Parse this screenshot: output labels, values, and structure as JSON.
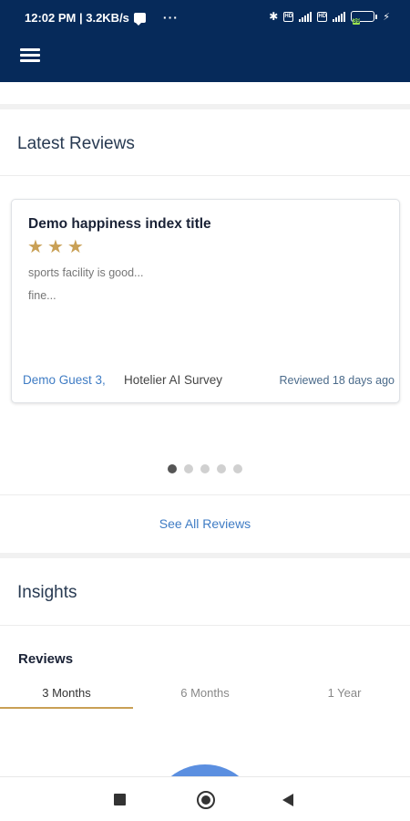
{
  "status_bar": {
    "time_speed": "12:02 PM | 3.2KB/s",
    "more": "···",
    "battery_level": "39",
    "charging_icon": "bolt-icon"
  },
  "app_bar": {
    "menu_icon": "hamburger-menu-icon",
    "background_color": "#062a5a"
  },
  "latest_reviews": {
    "title": "Latest Reviews",
    "card": {
      "title": "Demo happiness index title",
      "rating": 3,
      "star_color": "#c9a055",
      "line1": "sports facility is good...",
      "line2": "fine...",
      "guest": "Demo Guest 3,",
      "survey": "Hotelier AI Survey",
      "time": "Reviewed 18 days ago"
    },
    "carousel_pages": 5,
    "active_page": 1,
    "see_all": "See All Reviews"
  },
  "insights": {
    "title": "Insights",
    "subtitle": "Reviews",
    "tabs": [
      {
        "label": "3 Months"
      },
      {
        "label": "6 Months"
      },
      {
        "label": "1 Year"
      }
    ],
    "active_tab": 0
  },
  "nav_bar": {
    "recents_icon": "square-recents-icon",
    "home_icon": "circle-home-icon",
    "back_icon": "triangle-back-icon"
  }
}
